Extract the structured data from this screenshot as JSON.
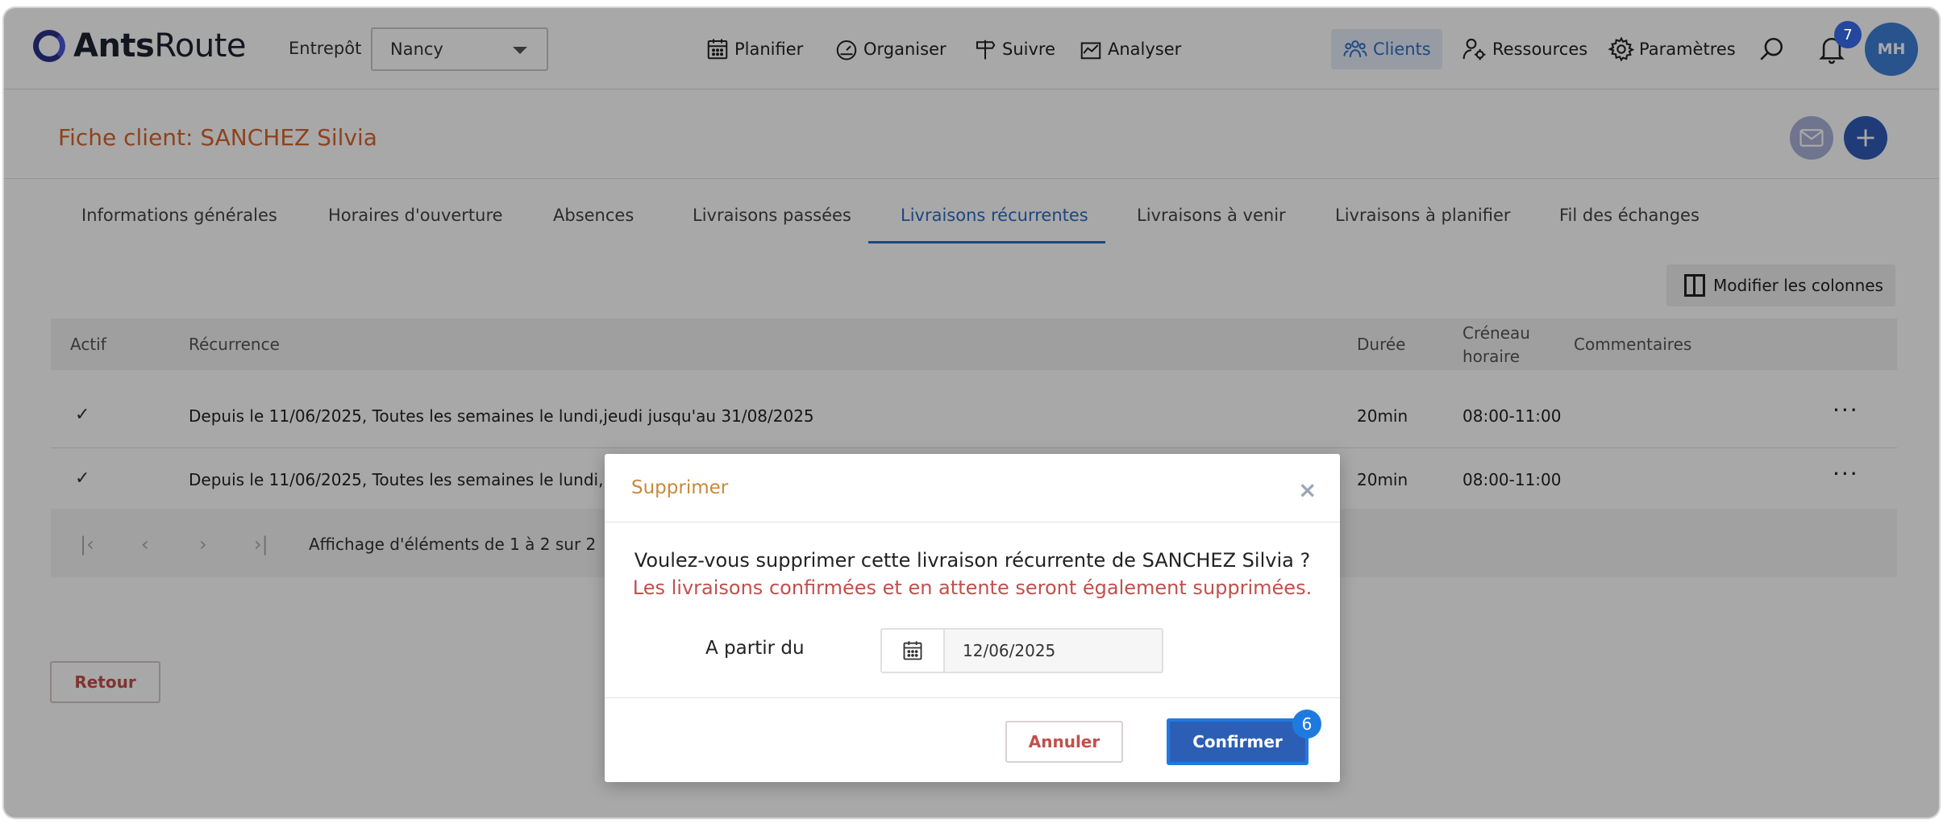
{
  "app": {
    "logo_bold": "Ants",
    "logo_regular": "Route"
  },
  "header": {
    "warehouse_label": "Entrepôt",
    "warehouse_value": "Nancy",
    "nav": [
      {
        "label": "Planifier",
        "icon": "calendar-icon"
      },
      {
        "label": "Organiser",
        "icon": "gauge-icon"
      },
      {
        "label": "Suivre",
        "icon": "signpost-icon"
      },
      {
        "label": "Analyser",
        "icon": "chart-icon"
      }
    ],
    "right_nav": [
      {
        "label": "Clients",
        "icon": "users-icon",
        "active": true
      },
      {
        "label": "Ressources",
        "icon": "user-gear-icon"
      },
      {
        "label": "Paramètres",
        "icon": "gear-icon"
      }
    ],
    "notifications_count": "7",
    "avatar_initials": "MH"
  },
  "page": {
    "title": "Fiche client: SANCHEZ Silvia"
  },
  "tabs": [
    {
      "label": "Informations générales"
    },
    {
      "label": "Horaires d'ouverture"
    },
    {
      "label": "Absences"
    },
    {
      "label": "Livraisons passées"
    },
    {
      "label": "Livraisons récurrentes",
      "active": true
    },
    {
      "label": "Livraisons à venir"
    },
    {
      "label": "Livraisons à planifier"
    },
    {
      "label": "Fil des échanges"
    }
  ],
  "columns_button": "Modifier les colonnes",
  "table": {
    "headers": {
      "actif": "Actif",
      "recurrence": "Récurrence",
      "duree": "Durée",
      "creneau_1": "Créneau",
      "creneau_2": "horaire",
      "commentaires": "Commentaires"
    },
    "rows": [
      {
        "actif": "✓",
        "recurrence": "Depuis le 11/06/2025, Toutes les semaines le lundi,jeudi jusqu'au 31/08/2025",
        "duree": "20min",
        "creneau": "08:00-11:00",
        "commentaires": ""
      },
      {
        "actif": "✓",
        "recurrence": "Depuis le 11/06/2025, Toutes les semaines le lundi,mer",
        "duree": "20min",
        "creneau": "08:00-11:00",
        "commentaires": ""
      }
    ],
    "pagination_text": "Affichage d'éléments de 1 à 2 sur 2"
  },
  "back_button": "Retour",
  "modal": {
    "title": "Supprimer",
    "question": "Voulez-vous supprimer cette livraison récurrente de SANCHEZ Silvia ?",
    "warning": "Les livraisons confirmées et en attente seront également supprimées.",
    "date_label": "A partir du",
    "date_value": "12/06/2025",
    "cancel_label": "Annuler",
    "confirm_label": "Confirmer",
    "step_badge": "6"
  },
  "colors": {
    "accent": "#2d5eb5",
    "title_orange": "#d8652d",
    "danger": "#c0504d",
    "modal_title": "#c9893a"
  }
}
